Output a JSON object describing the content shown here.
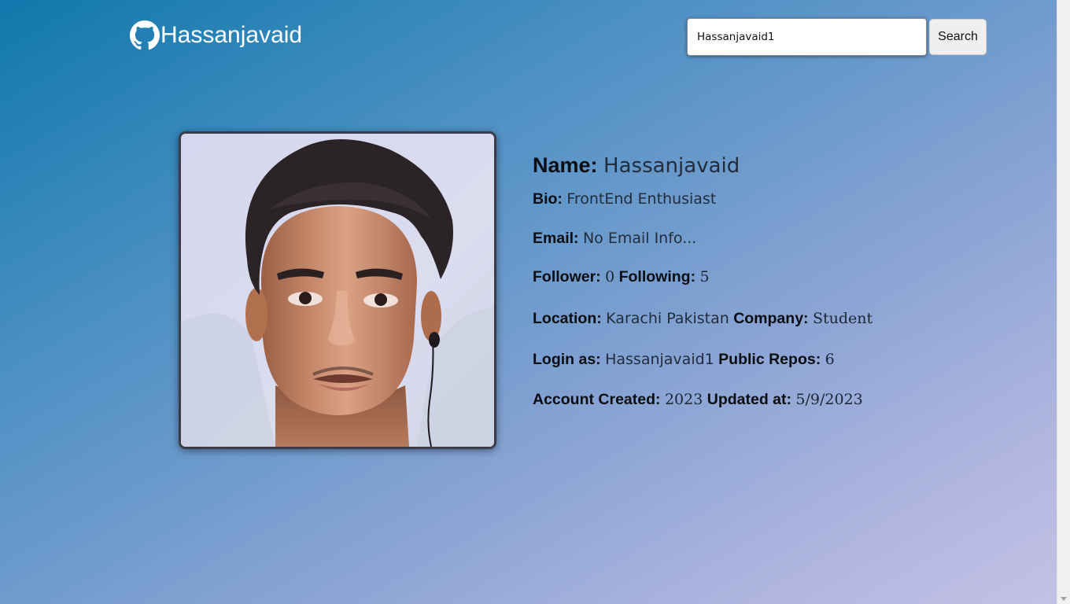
{
  "header": {
    "title": "Hassanjavaid",
    "logo_icon": "github-icon"
  },
  "search": {
    "value": "Hassanjavaid1",
    "button_label": "Search"
  },
  "profile": {
    "avatar_alt": "Profile photo",
    "name_label": "Name:",
    "name": "Hassanjavaid",
    "bio_label": "Bio:",
    "bio": "FrontEnd Enthusiast",
    "email_label": "Email:",
    "email": "No Email Info...",
    "follower_label": "Follower:",
    "follower": "0",
    "following_label": "Following:",
    "following": "5",
    "location_label": "Location:",
    "location": "Karachi Pakistan",
    "company_label": "Company:",
    "company": "Student",
    "login_label": "Login as:",
    "login": "Hassanjavaid1",
    "repos_label": "Public Repos:",
    "repos": "6",
    "created_label": "Account Created:",
    "created": "2023",
    "updated_label": "Updated at:",
    "updated": "5/9/2023"
  }
}
